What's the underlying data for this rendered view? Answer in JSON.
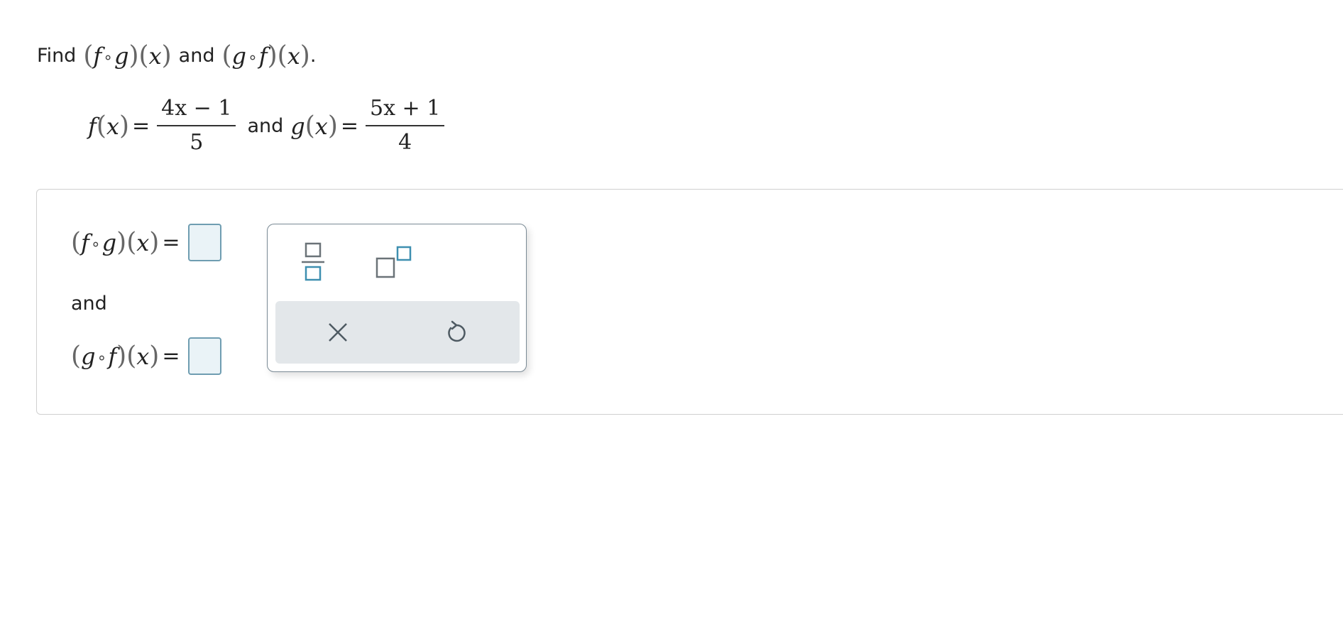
{
  "prompt": {
    "find_label": "Find",
    "and_label": "and",
    "period": ".",
    "f": "f",
    "g": "g",
    "x": "x",
    "compose": "∘"
  },
  "givens": {
    "f_name": "f",
    "g_name": "g",
    "x": "x",
    "equals": "=",
    "f_numerator": "4x − 1",
    "f_denominator": "5",
    "and_label": "and",
    "g_numerator": "5x + 1",
    "g_denominator": "4"
  },
  "answers": {
    "row1_lhs_first": "f",
    "row1_lhs_second": "g",
    "row2_lhs_first": "g",
    "row2_lhs_second": "f",
    "x": "x",
    "compose": "∘",
    "equals": "=",
    "and_label": "and",
    "fog_value": "",
    "gof_value": ""
  },
  "palette": {
    "fraction_icon": "fraction-template-icon",
    "exponent_icon": "exponent-template-icon",
    "clear_icon": "close-icon",
    "undo_icon": "undo-icon"
  },
  "colors": {
    "box_border": "#6f9db1",
    "box_fill": "#eaf3f7",
    "icon_accent": "#3e8fb0",
    "icon_gray": "#6b7378",
    "action_bar": "#e3e7ea"
  }
}
